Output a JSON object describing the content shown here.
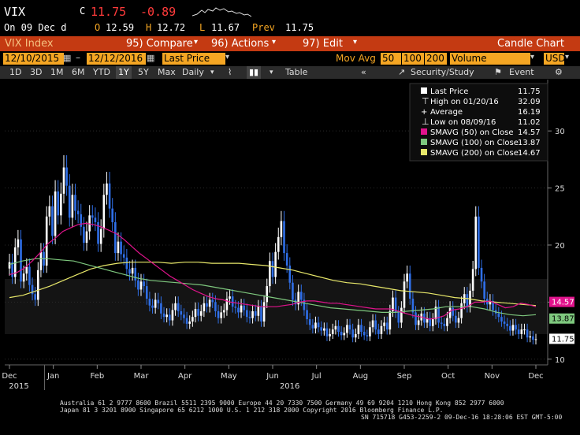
{
  "quote": {
    "ticker": "VIX",
    "c_label": "C",
    "last": "11.75",
    "change": "-0.89",
    "on": "On 09 Dec d",
    "o_label": "O",
    "open": "12.59",
    "h_label": "H",
    "high": "12.72",
    "l_label": "L",
    "low": "11.67",
    "prev_label": "Prev",
    "prev": "11.75"
  },
  "toolbar": {
    "security": "VIX Index",
    "compare_label": "95) Compare",
    "actions_label": "96) Actions",
    "edit_label": "97) Edit",
    "chart_type": "Candle Chart"
  },
  "range": {
    "start": "12/10/2015",
    "end": "12/12/2016",
    "field": "Last Price",
    "mov_avg_label": "Mov Avg",
    "ma1": "50",
    "ma2": "100",
    "ma3": "200",
    "lower": "Volume",
    "currency": "USD"
  },
  "periods": {
    "items": [
      "1D",
      "3D",
      "1M",
      "6M",
      "YTD",
      "1Y",
      "5Y",
      "Max"
    ],
    "selected": "1Y",
    "frequency": "Daily",
    "table_label": "Table",
    "security_study": "Security/Study",
    "event": "Event"
  },
  "legend": {
    "last_price_label": "Last Price",
    "last_price": "11.75",
    "high_label": "High on 01/20/16",
    "high": "32.09",
    "average_label": "Average",
    "average": "16.19",
    "low_label": "Low on 08/09/16",
    "low": "11.02",
    "sma50_label": "SMAVG (50) on Close",
    "sma50": "14.57",
    "sma100_label": "SMAVG (100) on Close",
    "sma100": "13.87",
    "sma200_label": "SMAVG (200) on Close",
    "sma200": "14.67"
  },
  "footer": {
    "line1": "Australia 61 2 9777 8600 Brazil 5511 2395 9000 Europe 44 20 7330 7500 Germany 49 69 9204 1210 Hong Kong 852 2977 6000",
    "line2": "Japan 81 3 3201 8900         Singapore 65 6212 1000         U.S. 1 212 318 2000          Copyright 2016 Bloomberg Finance L.P.",
    "line3": "SN 715718 G453-2259-2 09-Dec-16 18:28:06 EST  GMT-5:00"
  },
  "colors": {
    "up": "#ffffff",
    "down": "#2f6fe8",
    "sma50": "#e0138c",
    "sma100": "#7ec87e",
    "sma200": "#e8e86a",
    "amber": "#f5a623"
  },
  "chart_data": {
    "type": "candlestick",
    "ylim": [
      9.5,
      34.5
    ],
    "y_ticks": [
      10,
      15,
      20,
      25,
      30
    ],
    "x_months": [
      "Dec",
      "Jan",
      "Feb",
      "Mar",
      "Apr",
      "May",
      "Jun",
      "Jul",
      "Aug",
      "Sep",
      "Oct",
      "Nov",
      "Dec"
    ],
    "x_years": [
      "2015",
      "2016"
    ],
    "closes": [
      18.5,
      17.2,
      19.8,
      20.5,
      16.8,
      17.5,
      18.1,
      16.5,
      15.7,
      15.2,
      17.8,
      19.4,
      18.2,
      22.5,
      23.4,
      20.8,
      24.7,
      22.6,
      24.5,
      26.8,
      25.2,
      22.4,
      24.4,
      23.0,
      22.7,
      21.6,
      20.2,
      21.2,
      22.6,
      22.4,
      22.0,
      20.1,
      21.4,
      24.4,
      25.4,
      23.2,
      22.0,
      19.3,
      20.3,
      19.2,
      18.9,
      17.9,
      17.5,
      18.0,
      16.9,
      16.1,
      16.8,
      16.4,
      15.3,
      14.7,
      14.5,
      15.2,
      14.9,
      14.0,
      13.7,
      13.9,
      13.4,
      14.3,
      14.9,
      14.2,
      13.9,
      13.6,
      13.1,
      13.3,
      13.7,
      14.4,
      13.8,
      14.2,
      14.9,
      14.6,
      15.2,
      15.0,
      14.2,
      13.6,
      14.1,
      14.3,
      15.3,
      15.5,
      14.6,
      14.5,
      14.1,
      14.7,
      14.3,
      13.7,
      13.6,
      14.2,
      13.8,
      14.6,
      13.3,
      15.0,
      16.4,
      18.6,
      17.2,
      19.4,
      20.7,
      22.1,
      19.3,
      18.2,
      16.7,
      15.2,
      14.8,
      15.9,
      15.2,
      14.3,
      13.5,
      13.0,
      12.7,
      13.2,
      12.8,
      12.5,
      12.7,
      12.0,
      12.2,
      12.6,
      12.9,
      12.4,
      12.1,
      12.3,
      13.0,
      12.6,
      11.9,
      12.2,
      13.0,
      12.4,
      12.1,
      12.0,
      12.8,
      13.4,
      12.6,
      12.2,
      12.9,
      13.2,
      12.6,
      14.2,
      15.4,
      14.1,
      13.2,
      14.5,
      16.8,
      17.5,
      15.3,
      14.1,
      13.0,
      13.4,
      14.0,
      13.2,
      13.6,
      12.9,
      13.5,
      14.6,
      13.2,
      13.1,
      12.9,
      13.6,
      14.5,
      13.8,
      13.2,
      13.6,
      14.9,
      15.7,
      14.6,
      16.0,
      17.9,
      22.5,
      18.0,
      16.8,
      15.3,
      14.8,
      15.1,
      14.3,
      14.0,
      13.7,
      13.3,
      13.1,
      12.9,
      12.5,
      13.0,
      12.6,
      12.2,
      12.6,
      12.6,
      11.9,
      12.0,
      11.7,
      11.75
    ],
    "sma50": [
      17.4,
      17.6,
      18.0,
      18.6,
      19.3,
      20.1,
      20.6,
      21.2,
      21.5,
      21.8,
      21.9,
      21.8,
      21.6,
      21.3,
      21.0,
      20.5,
      19.9,
      19.3,
      18.8,
      18.3,
      17.8,
      17.3,
      16.9,
      16.5,
      16.1,
      15.8,
      15.5,
      15.3,
      15.2,
      15.0,
      14.9,
      14.8,
      14.7,
      14.6,
      14.6,
      14.6,
      14.7,
      14.8,
      15.0,
      15.1,
      15.1,
      15.0,
      14.9,
      14.9,
      14.8,
      14.7,
      14.6,
      14.5,
      14.4,
      14.4,
      14.4,
      14.2,
      14.0,
      13.8,
      13.7,
      13.5,
      13.6,
      13.8,
      14.3,
      14.4,
      14.6,
      15.0,
      15.0,
      15.1,
      14.8,
      14.5,
      14.6,
      14.9,
      14.8,
      14.6
    ],
    "sma100": [
      18.3,
      18.6,
      18.8,
      18.8,
      18.7,
      18.6,
      18.3,
      18.0,
      17.7,
      17.4,
      17.1,
      16.9,
      16.8,
      16.7,
      16.6,
      16.5,
      16.3,
      16.1,
      15.9,
      15.7,
      15.5,
      15.3,
      15.1,
      14.9,
      14.7,
      14.5,
      14.4,
      14.3,
      14.2,
      14.1,
      14.1,
      14.2,
      14.3,
      14.4,
      14.6,
      14.6,
      14.6,
      14.4,
      14.1,
      13.9,
      13.8,
      13.9
    ],
    "sma200": [
      15.4,
      15.6,
      16.0,
      16.4,
      16.9,
      17.4,
      17.9,
      18.2,
      18.4,
      18.5,
      18.5,
      18.5,
      18.4,
      18.5,
      18.5,
      18.4,
      18.4,
      18.4,
      18.3,
      18.2,
      18.0,
      17.8,
      17.5,
      17.2,
      16.9,
      16.7,
      16.6,
      16.4,
      16.2,
      16.0,
      15.9,
      15.8,
      15.6,
      15.4,
      15.3,
      15.1,
      15.0,
      14.9,
      14.8,
      14.7
    ]
  }
}
